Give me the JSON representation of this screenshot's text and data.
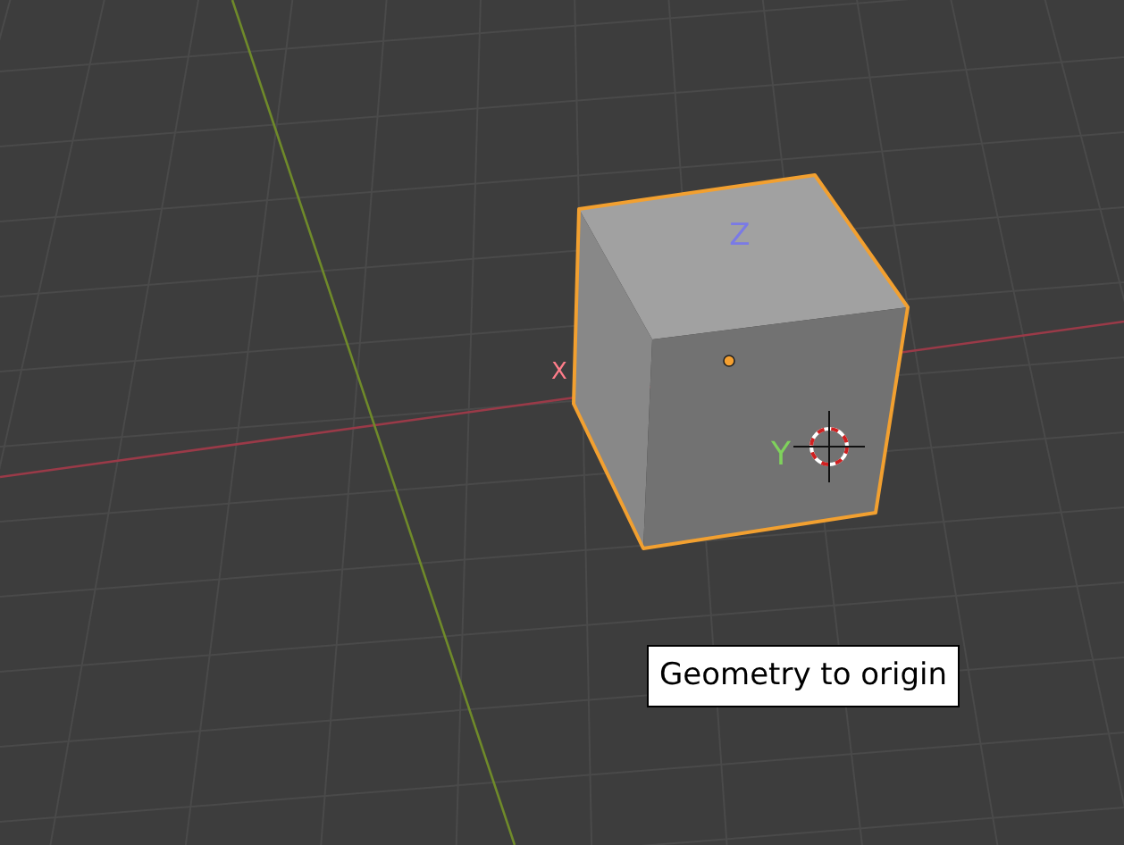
{
  "viewport": {
    "axis_labels": [
      {
        "text": "Z",
        "color": "#7a7ae6"
      },
      {
        "text": "Y",
        "color": "#7fd15c"
      },
      {
        "text": "X",
        "color": "#ff7d8a"
      }
    ]
  },
  "operator_label": {
    "text": "Geometry to origin"
  }
}
